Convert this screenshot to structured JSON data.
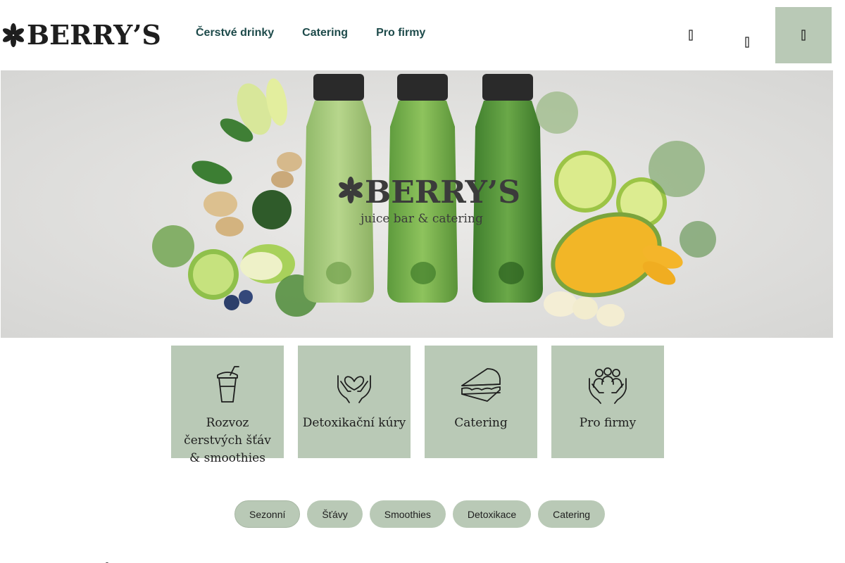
{
  "header": {
    "logo_text": "BERRY’S",
    "nav": [
      {
        "label": "Čerstvé drinky"
      },
      {
        "label": "Catering"
      },
      {
        "label": "Pro firmy"
      }
    ],
    "icons": [
      "user-icon",
      "search-icon",
      "cart-icon"
    ]
  },
  "hero": {
    "brand": "BERRY’S",
    "tagline": "juice bar & catering"
  },
  "tiles": [
    {
      "label": "Rozvoz čerstvých šťáv & smoothies",
      "icon": "drink-cup-icon"
    },
    {
      "label": "Detoxikační kúry",
      "icon": "heart-hands-icon"
    },
    {
      "label": "Catering",
      "icon": "sandwich-icon"
    },
    {
      "label": "Pro firmy",
      "icon": "team-hands-icon"
    }
  ],
  "pills": [
    {
      "label": "Sezonní",
      "active": true
    },
    {
      "label": "Šťávy"
    },
    {
      "label": "Smoothies"
    },
    {
      "label": "Detoxikace"
    },
    {
      "label": "Catering"
    }
  ],
  "colors": {
    "accent": "#b9c9b6",
    "nav_text": "#1d4a4a",
    "text": "#1e1e1e"
  }
}
